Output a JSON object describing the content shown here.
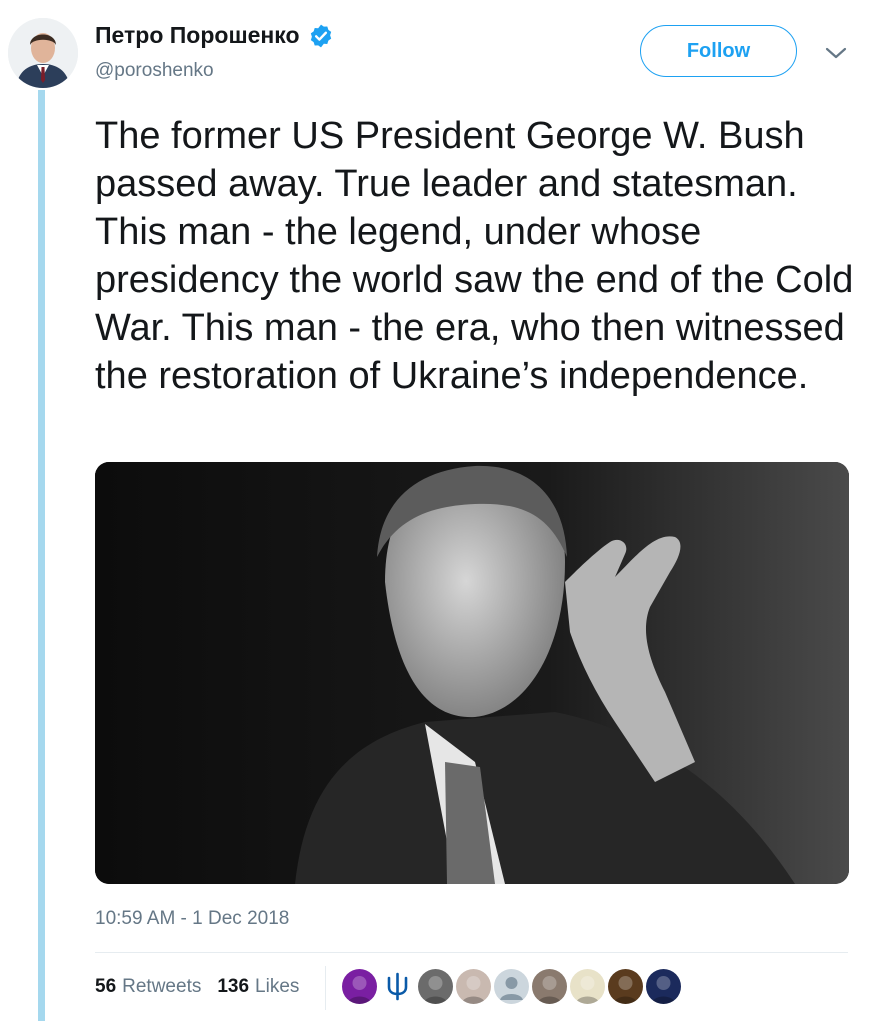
{
  "author": {
    "display_name": "Петро Порошенко",
    "handle": "@poroshenko",
    "verified": true,
    "avatar_icon": "profile-photo"
  },
  "follow_button": {
    "label": "Follow"
  },
  "menu": {
    "icon": "chevron-down-icon"
  },
  "tweet": {
    "text": "The former US President George W. Bush passed away. True leader and statesman. This man - the legend, under whose presidency the world saw the end of the Cold War. This man - the era, who then witnessed the restoration of Ukraine’s independence.",
    "timestamp": "10:59 AM - 1 Dec 2018"
  },
  "media": {
    "kind": "black-and-white portrait photo"
  },
  "stats": {
    "retweets": {
      "count": "56",
      "label": "Retweets"
    },
    "likes": {
      "count": "136",
      "label": "Likes"
    }
  },
  "likers": [
    {
      "color": "#7a1fa2"
    },
    {
      "color": "#ffffff",
      "icon": "trident-icon"
    },
    {
      "color": "#6b6b6b"
    },
    {
      "color": "#c9b9b0"
    },
    {
      "color": "#ccd6dd",
      "icon": "default-avatar-icon"
    },
    {
      "color": "#8a7a6e"
    },
    {
      "color": "#e8e2c8"
    },
    {
      "color": "#5a3b1e"
    },
    {
      "color": "#1b2a5c"
    }
  ],
  "colors": {
    "accent": "#1da1f2",
    "thread_line": "#a5d8ee",
    "text_primary": "#14171a",
    "text_secondary": "#657786"
  }
}
